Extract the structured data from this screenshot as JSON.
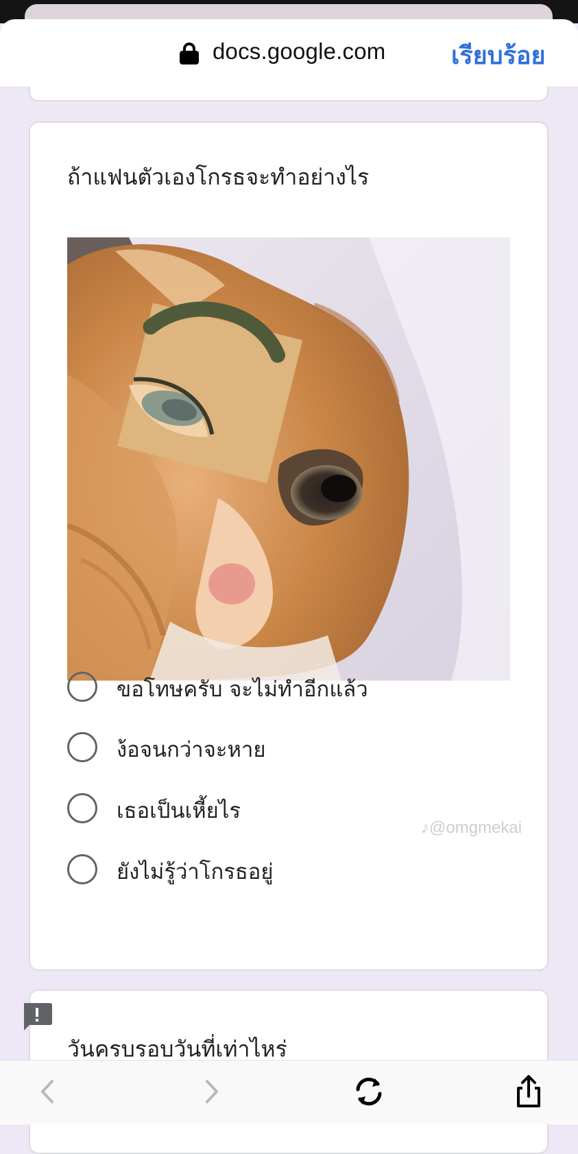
{
  "browser": {
    "url": "docs.google.com",
    "done_label": "เรียบร้อย"
  },
  "question": {
    "title": "ถ้าแฟนตัวเองโกรธจะทำอย่างไร",
    "image_alt": "cat-meme-image",
    "options": [
      {
        "label": "ขอโทษครับ จะไม่ทำอีกแล้ว"
      },
      {
        "label": "ง้อจนกว่าจะหาย"
      },
      {
        "label": "เธอเป็นเหี้ยไร"
      },
      {
        "label": "ยังไม่รู้ว่าโกรธอยู่"
      }
    ]
  },
  "next_question": {
    "title": "วันครบรอบวันที่เท่าไหร่"
  },
  "watermark": "♪@omgmekai"
}
